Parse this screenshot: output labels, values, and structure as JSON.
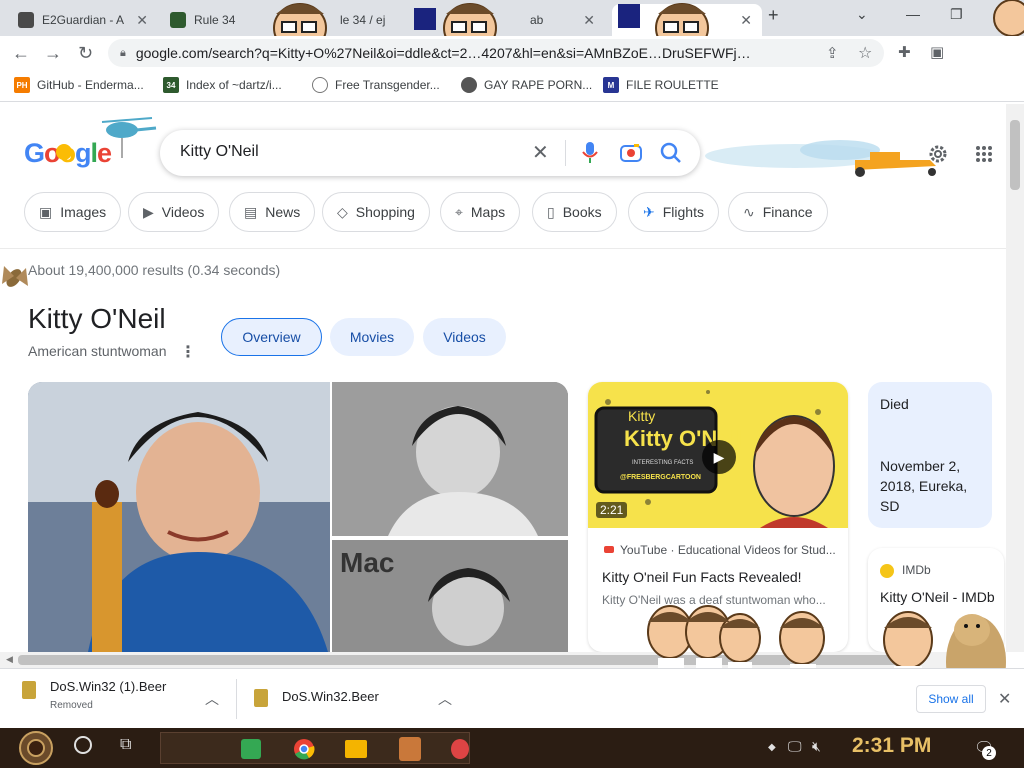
{
  "tabs": [
    {
      "title": "E2Guardian - A",
      "color": "#4a4a4a"
    },
    {
      "title": "Rule 34",
      "color": "#2e5a2e"
    },
    {
      "title": "le 34 / ej",
      "color": "#7a5a3a"
    },
    {
      "title": "ab",
      "color": "#5a5a7a"
    }
  ],
  "address": {
    "url": "google.com/search?q=Kitty+O%27Neil&oi=ddle&ct=2…4207&hl=en&si=AMnBZoE…DruSEFWFj…"
  },
  "bookmarks": [
    {
      "label": "GitHub - Enderma...",
      "icon_text": "PH",
      "icon_color": "#f57c00"
    },
    {
      "label": "Index of ~dartz/i...",
      "icon_text": "34",
      "icon_color": "#2e5a2e"
    },
    {
      "label": "Free Transgender...",
      "icon_text": "",
      "icon_color": "#555555"
    },
    {
      "label": "GAY RAPE PORN...",
      "icon_text": "",
      "icon_color": "#555555"
    },
    {
      "label": "FILE ROULETTE",
      "icon_text": "M",
      "icon_color": "#283593"
    }
  ],
  "google": {
    "logo_text": "Google",
    "query": "Kitty O'Neil"
  },
  "chips": [
    {
      "label": "Images",
      "icon": "image-icon"
    },
    {
      "label": "Videos",
      "icon": "play-icon"
    },
    {
      "label": "News",
      "icon": "news-icon"
    },
    {
      "label": "Shopping",
      "icon": "tag-icon"
    },
    {
      "label": "Maps",
      "icon": "pin-icon"
    },
    {
      "label": "Books",
      "icon": "book-icon"
    },
    {
      "label": "Flights",
      "icon": "plane-icon"
    },
    {
      "label": "Finance",
      "icon": "chart-icon"
    }
  ],
  "results_stats": "About 19,400,000 results (0.34 seconds)",
  "knowledge_panel": {
    "title": "Kitty O'Neil",
    "subtitle": "American stuntwoman",
    "tabs": [
      "Overview",
      "Movies",
      "Videos"
    ]
  },
  "video_card": {
    "thumb_title": "Kitty O'Neil",
    "thumb_subtitle": "INTERESTING FACTS",
    "thumb_handle": "@FRESBERGCARTOON",
    "duration": "2:21",
    "source": "YouTube · Educational Videos for Stud...",
    "title": "Kitty O'neil Fun Facts Revealed!",
    "snippet": "Kitty O'Neil was a deaf stuntwoman who..."
  },
  "died_card": {
    "label": "Died",
    "value": "November 2, 2018, Eureka, SD"
  },
  "imdb_card": {
    "source": "IMDb",
    "title": "Kitty O'Neil - IMDb"
  },
  "downloads": [
    {
      "name": "DoS.Win32 (1).Beer",
      "status": "Removed"
    },
    {
      "name": "DoS.Win32.Beer",
      "status": ""
    }
  ],
  "downloads_show_all": "Show all",
  "taskbar": {
    "time": "2:31 PM",
    "notification_count": "2"
  },
  "colors": {
    "google_blue": "#4285f4",
    "google_red": "#ea4335",
    "google_yellow": "#fbbc05",
    "google_green": "#34a853",
    "taskbar_bg": "#2b1d13",
    "clock": "#e8c066"
  }
}
